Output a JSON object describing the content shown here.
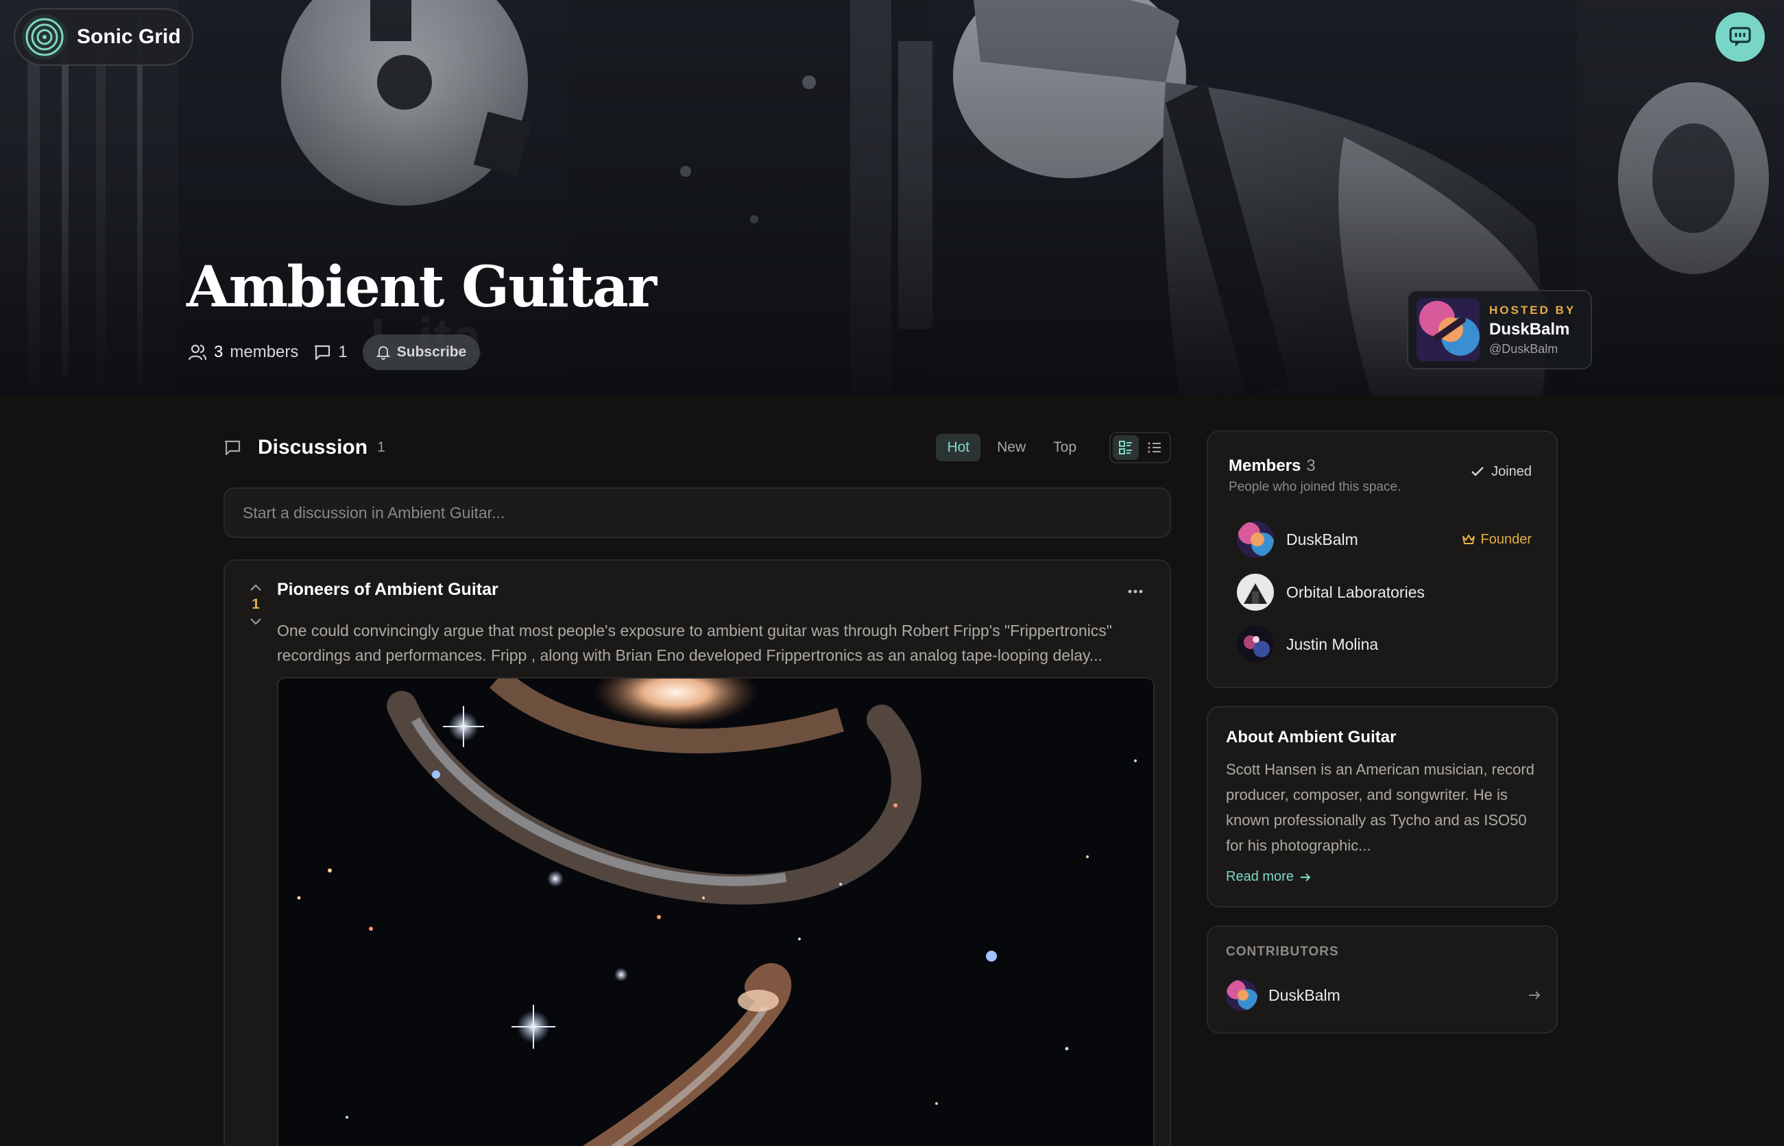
{
  "app": {
    "name": "Sonic Grid",
    "logo_icon": "vinyl-spiral-icon",
    "chat_icon": "chat-bubble-icon"
  },
  "space": {
    "title": "Ambient Guitar",
    "members_count": "3",
    "members_label": "members",
    "posts_count": "1",
    "subscribe_label": "Subscribe"
  },
  "host": {
    "kicker": "HOSTED BY",
    "name": "DuskBalm",
    "handle": "@DuskBalm"
  },
  "discussion": {
    "title": "Discussion",
    "count": "1",
    "sort_tabs": [
      "Hot",
      "New",
      "Top"
    ],
    "active_sort": "Hot",
    "composer_placeholder": "Start a discussion in Ambient Guitar..."
  },
  "post": {
    "title": "Pioneers of Ambient Guitar",
    "votes": "1",
    "excerpt_line1": "One could convincingly argue that most people's exposure to ambient guitar was through Robert Fripp's \"Frippertronics\"",
    "excerpt_line2": "recordings and performances. Fripp , along with Brian Eno developed Frippertronics as an analog tape-looping delay..."
  },
  "members": {
    "title": "Members",
    "count": "3",
    "subtitle": "People who joined this space.",
    "joined_label": "Joined",
    "list": [
      {
        "name": "DuskBalm",
        "badge": "Founder"
      },
      {
        "name": "Orbital Laboratories",
        "badge": ""
      },
      {
        "name": "Justin Molina",
        "badge": ""
      }
    ]
  },
  "about": {
    "title": "About Ambient Guitar",
    "text": "Scott Hansen is an American musician, record producer, composer, and songwriter. He is known professionally as Tycho and as ISO50 for his photographic...",
    "read_more": "Read more"
  },
  "contributors": {
    "kicker": "CONTRIBUTORS",
    "list": [
      {
        "name": "DuskBalm"
      }
    ]
  },
  "colors": {
    "accent": "#79d6c6",
    "gold": "#e6ad45",
    "background": "#141211",
    "card": "#1a1918"
  }
}
